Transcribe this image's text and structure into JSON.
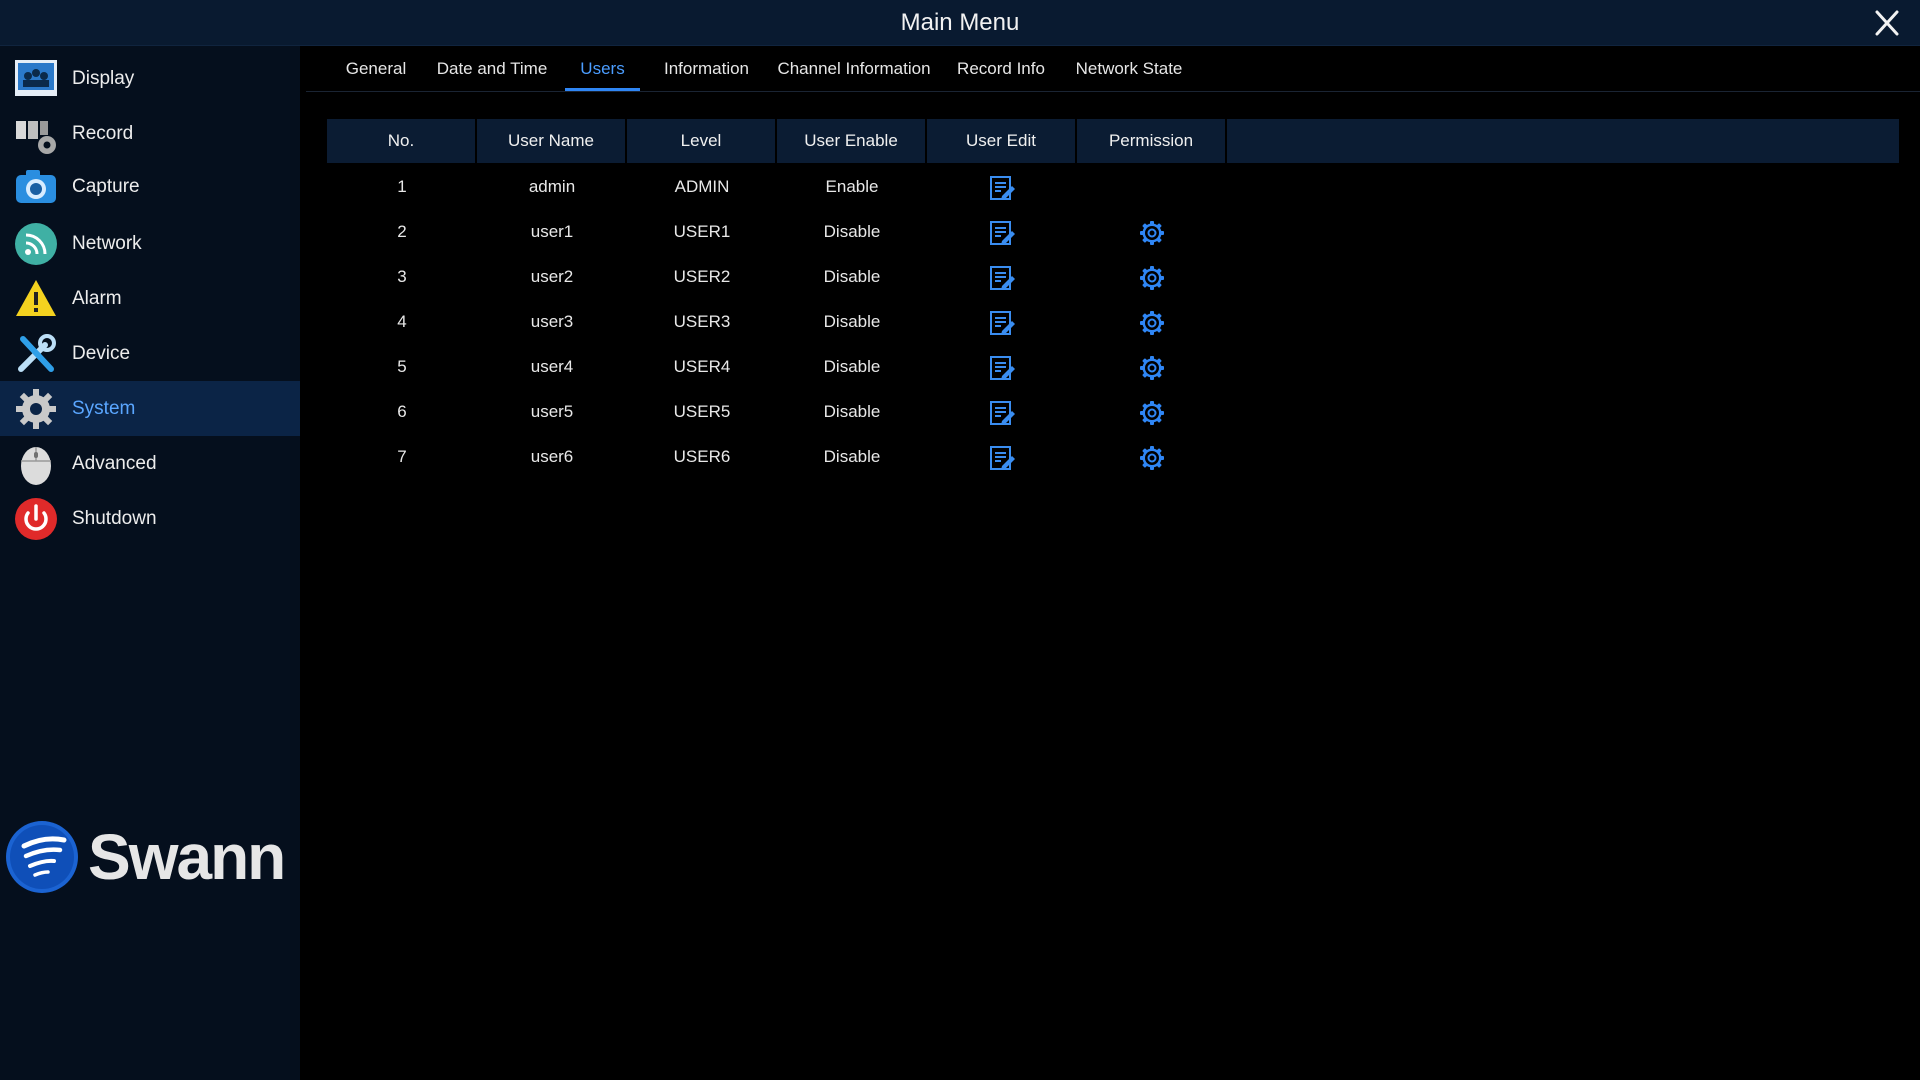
{
  "window": {
    "title": "Main Menu",
    "close_icon": "close-icon"
  },
  "sidebar": {
    "items": [
      {
        "label": "Display",
        "icon": "display-icon",
        "active": false
      },
      {
        "label": "Record",
        "icon": "record-icon",
        "active": false
      },
      {
        "label": "Capture",
        "icon": "camera-icon",
        "active": false
      },
      {
        "label": "Network",
        "icon": "network-icon",
        "active": false
      },
      {
        "label": "Alarm",
        "icon": "alarm-icon",
        "active": false
      },
      {
        "label": "Device",
        "icon": "device-icon",
        "active": false
      },
      {
        "label": "System",
        "icon": "gear-icon",
        "active": true
      },
      {
        "label": "Advanced",
        "icon": "mouse-icon",
        "active": false
      },
      {
        "label": "Shutdown",
        "icon": "power-icon",
        "active": false
      }
    ],
    "logo": {
      "text": "Swann"
    }
  },
  "tabs": [
    {
      "label": "General",
      "active": false
    },
    {
      "label": "Date and Time",
      "active": false
    },
    {
      "label": "Users",
      "active": true
    },
    {
      "label": "Information",
      "active": false
    },
    {
      "label": "Channel Information",
      "active": false
    },
    {
      "label": "Record Info",
      "active": false
    },
    {
      "label": "Network State",
      "active": false
    }
  ],
  "table": {
    "headers": [
      "No.",
      "User Name",
      "Level",
      "User Enable",
      "User Edit",
      "Permission"
    ],
    "rows": [
      {
        "no": "1",
        "user_name": "admin",
        "level": "ADMIN",
        "user_enable": "Enable",
        "permission": false
      },
      {
        "no": "2",
        "user_name": "user1",
        "level": "USER1",
        "user_enable": "Disable",
        "permission": true
      },
      {
        "no": "3",
        "user_name": "user2",
        "level": "USER2",
        "user_enable": "Disable",
        "permission": true
      },
      {
        "no": "4",
        "user_name": "user3",
        "level": "USER3",
        "user_enable": "Disable",
        "permission": true
      },
      {
        "no": "5",
        "user_name": "user4",
        "level": "USER4",
        "user_enable": "Disable",
        "permission": true
      },
      {
        "no": "6",
        "user_name": "user5",
        "level": "USER5",
        "user_enable": "Disable",
        "permission": true
      },
      {
        "no": "7",
        "user_name": "user6",
        "level": "USER6",
        "user_enable": "Disable",
        "permission": true
      }
    ]
  },
  "colors": {
    "accent": "#2f86f5",
    "active_text": "#4b9dff",
    "header_bg": "#0b1c33",
    "sidebar_bg": "#050f1d"
  }
}
